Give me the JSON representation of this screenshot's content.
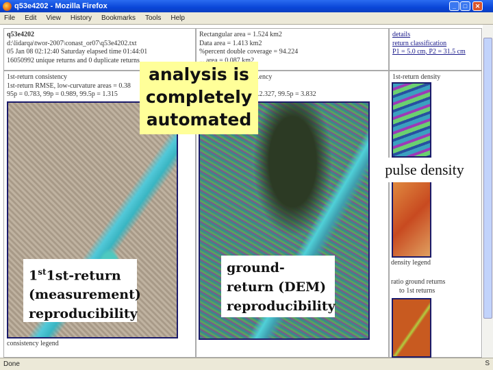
{
  "window": {
    "title": "q53e4202 - Mozilla Firefox",
    "min": "_",
    "max": "□",
    "close": "✕"
  },
  "menu": [
    "File",
    "Edit",
    "View",
    "History",
    "Bookmarks",
    "Tools",
    "Help"
  ],
  "info": {
    "lines": [
      "q53e4202",
      "d:\\lidarqa\\twor-2007\\conast_or07\\q53e4202.txt",
      "05 Jan 08 02:12:40 Saturday elapsed time 01:44:01",
      "16050992 unique returns and 0 duplicate returns"
    ]
  },
  "areas": {
    "lines": [
      "Rectangular area = 1.524 km2",
      "Data area = 1.413 km2",
      "%percent double coverage = 94.224",
      "... area = 0.087 km2"
    ]
  },
  "links": [
    "details",
    "return classification",
    "P1 = 5.0 cm, P2 = 31.5 cm"
  ],
  "left_panel": {
    "lines": [
      "1st-return consistency",
      "1st-return RMSE, low-curvature areas = 0.38",
      "95p = 0.783, 99p = 0.989, 99.5p = 1.315"
    ],
    "legend": "consistency legend"
  },
  "mid_panel": {
    "lines": [
      "...ency",
      "...2.327, 99.5p = 3.832"
    ]
  },
  "right_panel": {
    "title": "1st-return density",
    "legend": "density legend",
    "ratio1": "ratio ground returns",
    "ratio2": "to 1st returns"
  },
  "overlays": {
    "automated": "analysis is completely automated",
    "pulse": "pulse density",
    "first": "1st-return (measurement) reproducibility",
    "ground": "ground-return (DEM) reproducibility",
    "first_sup": "st"
  },
  "status": "Done",
  "status_icon": "S"
}
